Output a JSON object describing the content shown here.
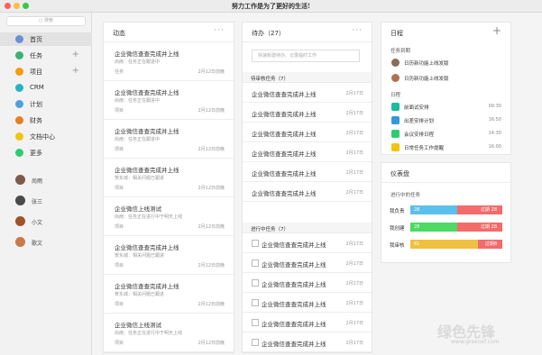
{
  "window": {
    "title": "努力工作是为了更好的生活!"
  },
  "search": {
    "placeholder": "搜索"
  },
  "nav": [
    {
      "label": "首页",
      "color": "#6a8fd8",
      "plus": ""
    },
    {
      "label": "任务",
      "color": "#3cb371",
      "plus": "+"
    },
    {
      "label": "项目",
      "color": "#f39c12",
      "plus": "+"
    },
    {
      "label": "CRM",
      "color": "#27b3c6",
      "plus": ""
    },
    {
      "label": "计划",
      "color": "#4aa3df",
      "plus": ""
    },
    {
      "label": "财务",
      "color": "#e67e22",
      "plus": ""
    },
    {
      "label": "文档中心",
      "color": "#f1c40f",
      "plus": ""
    },
    {
      "label": "更多",
      "color": "#2ecc71",
      "plus": ""
    }
  ],
  "users": [
    {
      "name": "尚雨",
      "color": "#7d5a4a"
    },
    {
      "name": "张三",
      "color": "#4a4a4a"
    },
    {
      "name": "小文",
      "color": "#a0522d"
    },
    {
      "name": "歌文",
      "color": "#c97a4a"
    }
  ],
  "feed": {
    "title": "动态",
    "more": "···",
    "items": [
      {
        "title": "企业微信查查完成并上线",
        "sub": "尚雨：任务正在跟进中",
        "tag": "任务",
        "time": "2月12日前晚"
      },
      {
        "title": "企业微信查查完成并上线",
        "sub": "尚雨：任务正在跟进中",
        "tag": "项目",
        "time": "2月12日前晚"
      },
      {
        "title": "企业微信查查完成并上线",
        "sub": "尚雨：任务正在跟进中",
        "tag": "项目",
        "time": "2月12日前晚"
      },
      {
        "title": "企业微信查查完成并上线",
        "sub": "贺东城：相关问题已跟进",
        "tag": "项目",
        "time": "2月12日前晚"
      },
      {
        "title": "企业微信上线测试",
        "sub": "尚雨：任务正在进行中于明天上线",
        "tag": "项目",
        "time": "2月12日前晚"
      },
      {
        "title": "企业微信查查完成并上线",
        "sub": "贺东城：相关问题已跟进",
        "tag": "项目",
        "time": "2月12日前晚"
      },
      {
        "title": "企业微信查查完成并上线",
        "sub": "贺东城：相关问题已跟进",
        "tag": "项目",
        "time": "2月12日前晚"
      },
      {
        "title": "企业微信上线测试",
        "sub": "尚雨：任务正在进行中于明天上线",
        "tag": "项目",
        "time": "2月12日前晚"
      }
    ]
  },
  "todo": {
    "title": "待办（27）",
    "more": "···",
    "input_placeholder": "快速新建待办、记录临时工作",
    "pending_title": "待审核任务（7）",
    "pending": [
      {
        "text": "企业微信查查完成并上线",
        "date": "2月17日"
      },
      {
        "text": "企业微信查查完成并上线",
        "date": "2月17日"
      },
      {
        "text": "企业微信查查完成并上线",
        "date": "2月17日"
      },
      {
        "text": "企业微信查查完成并上线",
        "date": "2月17日"
      },
      {
        "text": "企业微信查查完成并上线",
        "date": "2月17日"
      },
      {
        "text": "企业微信查查完成并上线",
        "date": "2月17日"
      }
    ],
    "progress_title": "进行中任务（7）",
    "progress": [
      {
        "text": "企业微信查查完成并上线",
        "date": "2月17日"
      },
      {
        "text": "企业微信查查完成并上线",
        "date": "2月17日"
      },
      {
        "text": "企业微信查查完成并上线",
        "date": "2月17日"
      },
      {
        "text": "企业微信查查完成并上线",
        "date": "2月17日"
      },
      {
        "text": "企业微信查查完成并上线",
        "date": "2月17日"
      },
      {
        "text": "企业微信查查完成并上线",
        "date": "2月17日"
      }
    ]
  },
  "schedule": {
    "title": "日程",
    "plus": "+",
    "mention_label": "任务到期",
    "mentions": [
      {
        "text": "日历新功能上线发版",
        "color": "#8b6b5a"
      },
      {
        "text": "日历新功能上线发版",
        "color": "#b07050"
      }
    ],
    "day_label": "日程",
    "events": [
      {
        "text": "前面试安排",
        "time": "09:30",
        "color": "#1abc9c"
      },
      {
        "text": "出差安排计划",
        "time": "16:50",
        "color": "#3498db"
      },
      {
        "text": "会议安排日程",
        "time": "14:30",
        "color": "#2ecc71"
      },
      {
        "text": "日常任务工作提醒",
        "time": "16:00",
        "color": "#f1c40f"
      }
    ]
  },
  "dashboard": {
    "title": "仪表盘",
    "subtitle": "进行中的任务",
    "rows": [
      {
        "label": "我负责",
        "value": "28",
        "overdue": "过期 28",
        "color": "#5bc0eb",
        "share": 0.51
      },
      {
        "label": "我创建",
        "value": "28",
        "overdue": "过期 28",
        "color": "#4cd964",
        "share": 0.51
      },
      {
        "label": "我审核",
        "value": "61",
        "overdue": "过期8",
        "color": "#f0c040",
        "share": 0.74
      }
    ]
  },
  "watermark": {
    "text": "绿色先锋",
    "url": "www.greenxf.com"
  }
}
